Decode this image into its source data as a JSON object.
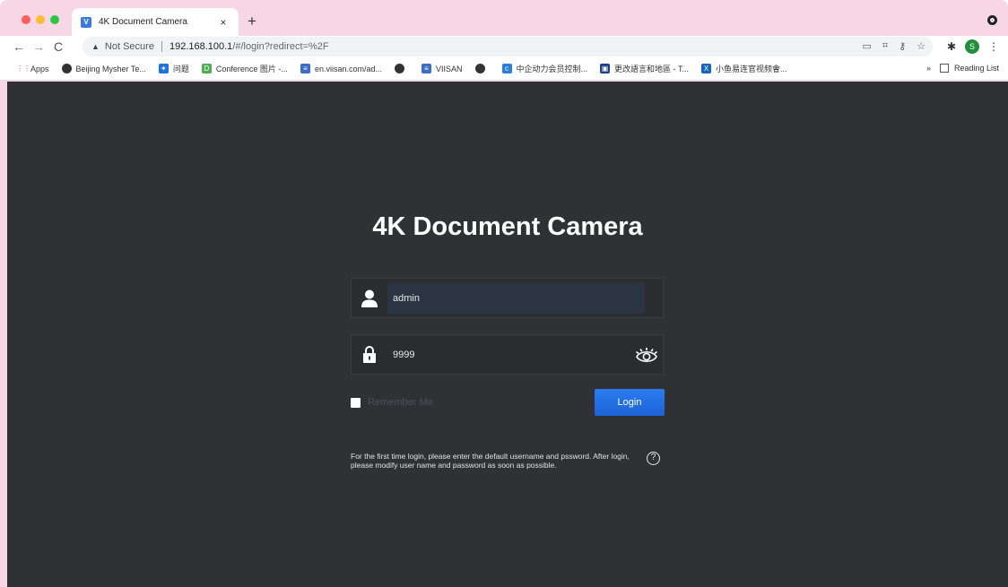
{
  "browser": {
    "tab_title": "4K Document Camera",
    "tab_close": "×",
    "new_tab": "+",
    "security_label": "Not Secure",
    "url_host": "192.168.100.1",
    "url_path": "/#/login?redirect=%2F",
    "profile_initial": "S",
    "bookmarks": [
      {
        "label": "Apps",
        "icon": "apps-grid-icon",
        "color": "#e8453c"
      },
      {
        "label": "Beijing Mysher Te...",
        "icon": "globe-icon",
        "color": "#333333"
      },
      {
        "label": "问题",
        "icon": "ribbon-icon",
        "color": "#1a73e8"
      },
      {
        "label": "Conference 图片 -...",
        "icon": "dx-icon",
        "color": "#4caf50"
      },
      {
        "label": "en.viisan.com/ad...",
        "icon": "viisan-icon",
        "color": "#3b6ec9"
      },
      {
        "label": "",
        "icon": "globe-icon",
        "color": "#333333"
      },
      {
        "label": "VIISAN",
        "icon": "viisan-icon",
        "color": "#3b6ec9"
      },
      {
        "label": "",
        "icon": "globe-icon",
        "color": "#333333"
      },
      {
        "label": "中企动力会员控制...",
        "icon": "cf-icon",
        "color": "#2a7de1"
      },
      {
        "label": "更改語言和地區 - T...",
        "icon": "translate-icon",
        "color": "#1a3e8f"
      },
      {
        "label": "小鱼易连官视频會...",
        "icon": "xo-icon",
        "color": "#1565c0"
      }
    ],
    "bookmarks_overflow": "»",
    "reading_list": "Reading List"
  },
  "login": {
    "title": "4K Document Camera",
    "username_value": "admin",
    "password_value": "9999",
    "remember_label": "Remember Me",
    "login_label": "Login",
    "hint": "For the first time login, please enter the default username and pssword. After login, please modify user name and password as soon as possible.",
    "help_glyph": "?"
  }
}
